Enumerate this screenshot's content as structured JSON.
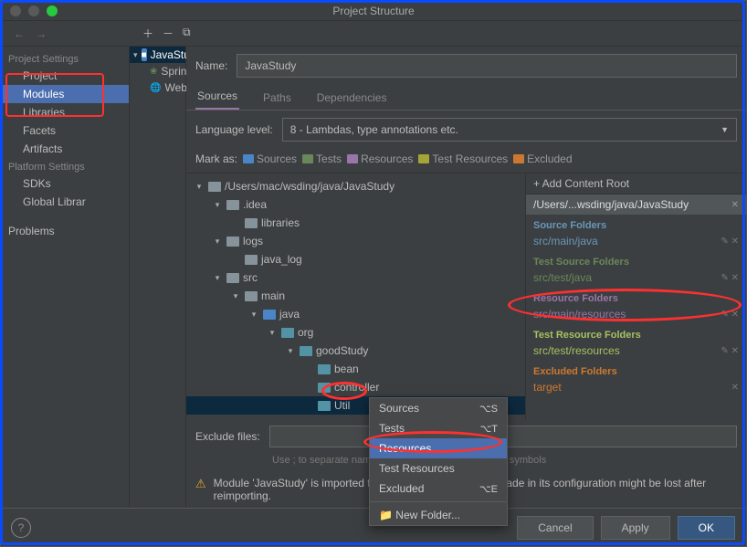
{
  "window_title": "Project Structure",
  "left": {
    "section1_title": "Project Settings",
    "project": "Project",
    "modules": "Modules",
    "libraries": "Libraries",
    "facets": "Facets",
    "artifacts": "Artifacts",
    "section2_title": "Platform Settings",
    "sdks": "SDKs",
    "global_libs": "Global Librar",
    "problems": "Problems"
  },
  "modtree": {
    "root": "JavaStudy",
    "spring": "Spring",
    "web": "Web"
  },
  "right": {
    "name_label": "Name:",
    "name_value": "JavaStudy",
    "tabs": {
      "sources": "Sources",
      "paths": "Paths",
      "deps": "Dependencies"
    },
    "lang_label": "Language level:",
    "lang_value": "8 - Lambdas, type annotations etc.",
    "mark_label": "Mark as:",
    "marks": {
      "sources": "Sources",
      "tests": "Tests",
      "resources": "Resources",
      "test_resources": "Test Resources",
      "excluded": "Excluded"
    }
  },
  "tree": {
    "root": "/Users/mac/wsding/java/JavaStudy",
    "idea": ".idea",
    "libraries": "libraries",
    "logs": "logs",
    "java_log": "java_log",
    "src": "src",
    "main": "main",
    "java": "java",
    "org": "org",
    "goodStudy": "goodStudy",
    "bean": "bean",
    "controller": "controller",
    "util": "Util"
  },
  "content_root": {
    "add": "+ Add Content Root",
    "path": "/Users/...wsding/java/JavaStudy",
    "source_title": "Source Folders",
    "source_item": "src/main/java",
    "test_src_title": "Test Source Folders",
    "test_src_item": "src/test/java",
    "res_title": "Resource Folders",
    "res_item": "src/main/resources",
    "test_res_title": "Test Resource Folders",
    "test_res_item": "src/test/resources",
    "excl_title": "Excluded Folders",
    "excl_item": "target"
  },
  "exclude": {
    "label": "Exclude files:",
    "hint": "Use ; to separate name patterns, * for any number of symbols"
  },
  "warning_text": "Module 'JavaStudy' is imported from Maven. Any changes made in its configuration might be lost after reimporting.",
  "ctx": {
    "sources": "Sources",
    "sources_kb": "⌥S",
    "tests": "Tests",
    "tests_kb": "⌥T",
    "resources": "Resources",
    "test_resources": "Test Resources",
    "excluded": "Excluded",
    "excluded_kb": "⌥E",
    "new_folder": "New Folder..."
  },
  "buttons": {
    "cancel": "Cancel",
    "apply": "Apply",
    "ok": "OK"
  },
  "colors": {
    "source": "#6897bb",
    "test": "#6a8759",
    "resource": "#9876aa",
    "test_resource": "#a5c261",
    "excluded": "#cc7832"
  }
}
